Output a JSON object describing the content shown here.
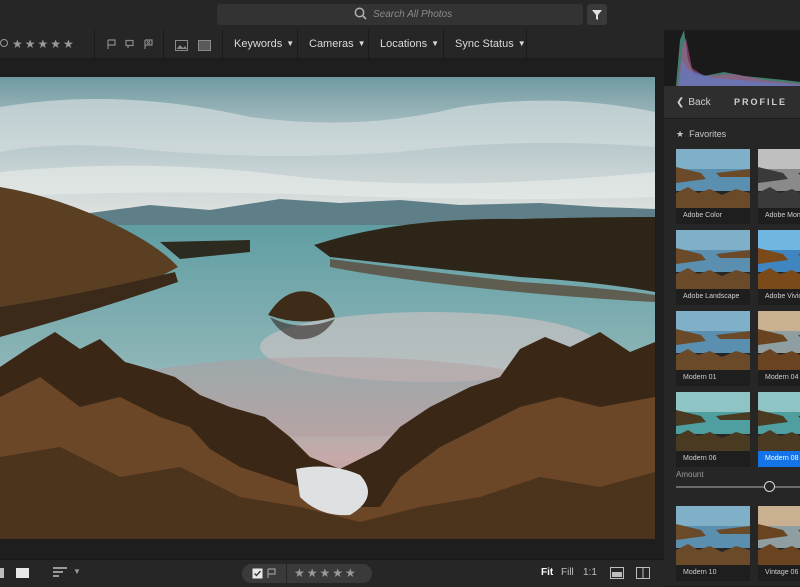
{
  "search": {
    "placeholder": "Search All Photos"
  },
  "filter_bar": {
    "rating_stars": "★★★★★",
    "dropdowns": [
      {
        "label": "Keywords"
      },
      {
        "label": "Cameras"
      },
      {
        "label": "Locations"
      },
      {
        "label": "Sync Status"
      }
    ]
  },
  "photo": {
    "description_icon": "image"
  },
  "panel": {
    "back_label": "Back",
    "title": "PROFILE",
    "section_label": "Favorites",
    "profiles": [
      {
        "label": "Adobe Color",
        "tone": "color"
      },
      {
        "label": "Adobe Monochrome",
        "tone": "mono"
      },
      {
        "label": "Adobe Landscape",
        "tone": "color"
      },
      {
        "label": "Adobe Vivid",
        "tone": "vivid"
      },
      {
        "label": "Modern 01",
        "tone": "color"
      },
      {
        "label": "Modern 04",
        "tone": "warm"
      },
      {
        "label": "Modern 06",
        "tone": "teal"
      },
      {
        "label": "Modern 08",
        "tone": "teal",
        "selected": true
      },
      {
        "label": "Modern 10",
        "tone": "color"
      },
      {
        "label": "Vintage 06",
        "tone": "warm"
      }
    ],
    "amount_label": "Amount",
    "amount_value": 0.75
  },
  "bottom": {
    "rating_stars": "★★★★★",
    "zoom_fit": "Fit",
    "zoom_fill": "Fill",
    "zoom_1to1": "1:1"
  },
  "colors": {
    "accent": "#1473e6",
    "background": "#1c1c1c",
    "panel": "#262626"
  }
}
